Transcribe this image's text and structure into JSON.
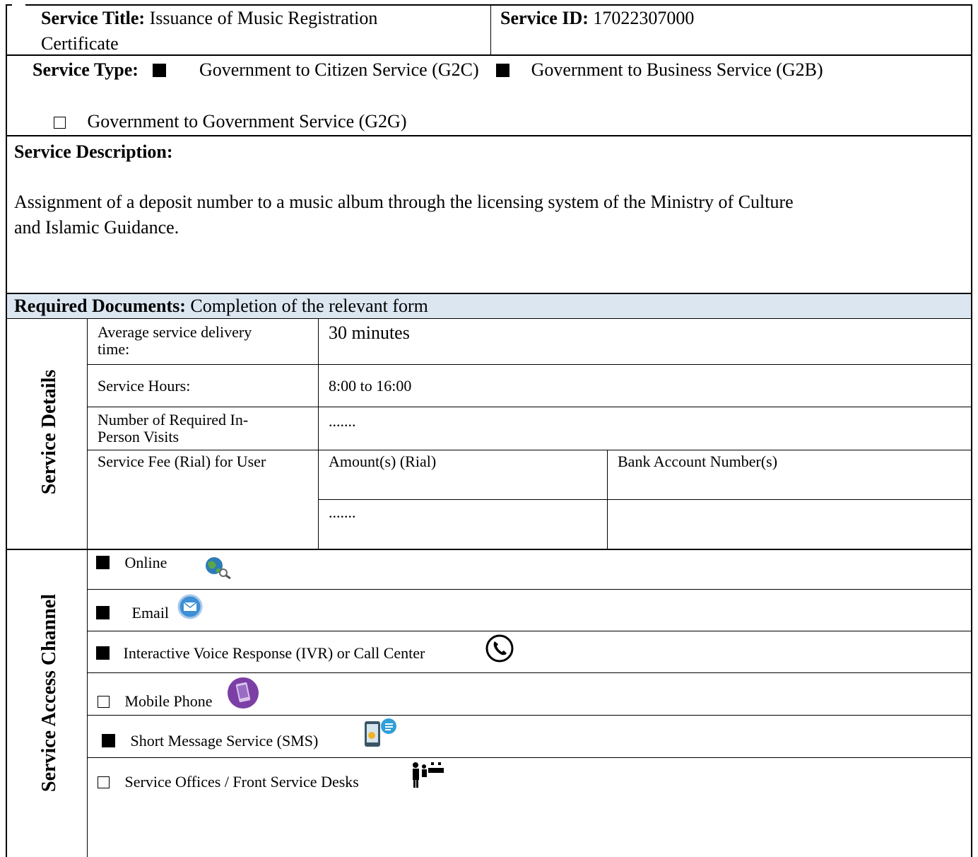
{
  "header": {
    "title_label": "Service Title:",
    "title_value_line1": "Issuance of Music Registration",
    "title_value_line2": "Certificate",
    "id_label": "Service ID:",
    "id_value": "17022307000"
  },
  "service_type": {
    "label": "Service Type:",
    "options": [
      {
        "label": "Government to Citizen Service (G2C)",
        "checked": true
      },
      {
        "label": "Government to Business Service (G2B)",
        "checked": true
      },
      {
        "label": "Government to Government Service (G2G)",
        "checked": false
      }
    ]
  },
  "description": {
    "label": "Service Description:",
    "line1": "Assignment of a deposit number to a music album through the licensing system of the Ministry of Culture",
    "line2": "and Islamic Guidance."
  },
  "required_docs": {
    "label": "Required Documents:",
    "value": "Completion of the relevant form",
    "bg_color": "#dce6f1"
  },
  "service_details": {
    "section_label": "Service Details",
    "delivery_time_label_1": "Average service delivery",
    "delivery_time_label_2": "time:",
    "delivery_time_value": "30 minutes",
    "hours_label": "Service Hours:",
    "hours_value": "8:00 to 16:00",
    "visits_label_1": "Number of Required In-",
    "visits_label_2": "Person Visits",
    "visits_value": ".......",
    "fee_label": "Service Fee (Rial) for User",
    "amount_header": "Amount(s) (Rial)",
    "bank_header": "Bank Account Number(s)",
    "amount_value": "......."
  },
  "access_channel": {
    "section_label": "Service Access Channel",
    "items": [
      {
        "label": "Online",
        "checked": true,
        "icon": "globe-icon"
      },
      {
        "label": "Email",
        "checked": true,
        "icon": "email-icon"
      },
      {
        "label": "Interactive Voice Response (IVR) or Call Center",
        "checked": true,
        "icon": "phone-icon"
      },
      {
        "label": "Mobile Phone",
        "checked": false,
        "icon": "mobile-phone-icon"
      },
      {
        "label": "Short Message Service (SMS)",
        "checked": true,
        "icon": "sms-icon"
      },
      {
        "label": "Service Offices / Front Service Desks",
        "checked": false,
        "icon": "service-desk-icon"
      }
    ]
  }
}
